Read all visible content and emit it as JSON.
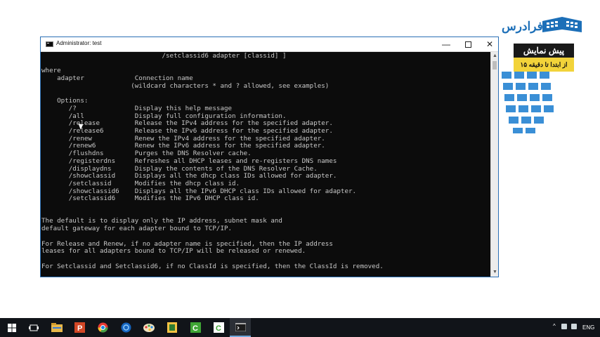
{
  "window": {
    "title": "Administrator: test",
    "minimize_glyph": "—",
    "close_glyph": "✕"
  },
  "console": {
    "lines": [
      "                               /setclassid6 adapter [classid] ]",
      "",
      "where",
      "    adapter             Connection name",
      "                       (wildcard characters * and ? allowed, see examples)",
      "",
      "    Options:",
      "       /?               Display this help message",
      "       /all             Display full configuration information.",
      "       /release         Release the IPv4 address for the specified adapter.",
      "       /release6        Release the IPv6 address for the specified adapter.",
      "       /renew           Renew the IPv4 address for the specified adapter.",
      "       /renew6          Renew the IPv6 address for the specified adapter.",
      "       /flushdns        Purges the DNS Resolver cache.",
      "       /registerdns     Refreshes all DHCP leases and re-registers DNS names",
      "       /displaydns      Display the contents of the DNS Resolver Cache.",
      "       /showclassid     Displays all the dhcp class IDs allowed for adapter.",
      "       /setclassid      Modifies the dhcp class id.",
      "       /showclassid6    Displays all the IPv6 DHCP class IDs allowed for adapter.",
      "       /setclassid6     Modifies the IPv6 DHCP class id.",
      "",
      "",
      "The default is to display only the IP address, subnet mask and",
      "default gateway for each adapter bound to TCP/IP.",
      "",
      "For Release and Renew, if no adapter name is specified, then the IP address",
      "leases for all adapters bound to TCP/IP will be released or renewed.",
      "",
      "For Setclassid and Setclassid6, if no ClassId is specified, then the ClassId is removed."
    ]
  },
  "scrollbar": {
    "up_glyph": "▲",
    "down_glyph": "▼"
  },
  "watermark": {
    "brand": "فرادرس",
    "promo_title": "پیش نمایش",
    "promo_subtitle": "از ابتدا تا دقیقه ۱۵",
    "brand_color": "#1c6fb8",
    "promo_accent": "#f2d33a"
  },
  "taskbar": {
    "language": "ENG",
    "tray_caret": "^",
    "icons": [
      "start-icon",
      "task-view-icon",
      "file-explorer-icon",
      "powerpoint-icon",
      "chrome-icon",
      "browser-icon",
      "paint-icon",
      "app-icon",
      "camtasia-icon",
      "camtasia-recorder-icon",
      "cmd-icon"
    ]
  }
}
